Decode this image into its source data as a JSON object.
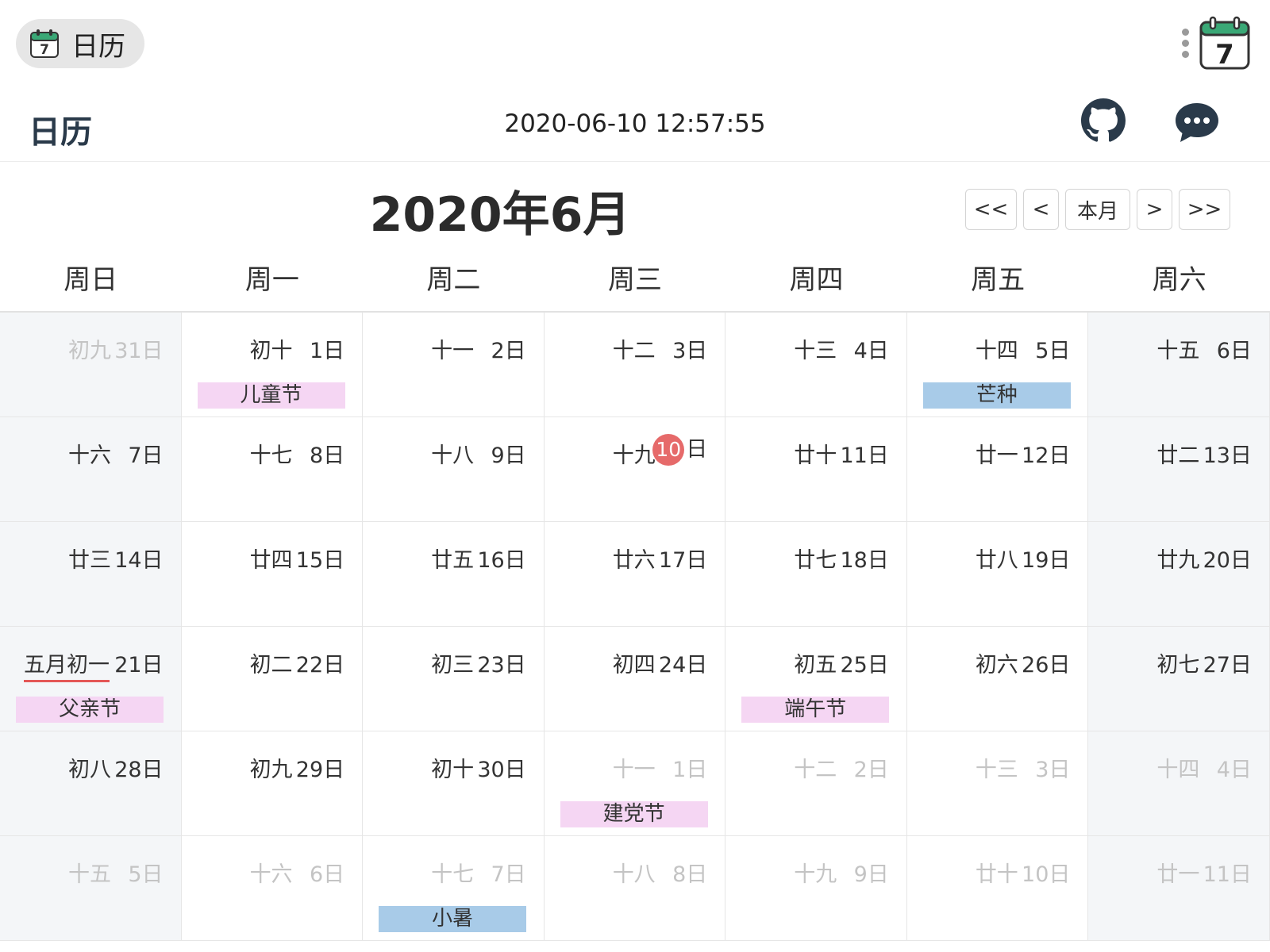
{
  "app": {
    "chip_title": "日历",
    "icon_day": "7"
  },
  "header": {
    "title": "日历",
    "datetime": "2020-06-10 12:57:55"
  },
  "calendar": {
    "month_title": "2020年6月",
    "nav": {
      "prev_year": "<<",
      "prev_month": "<",
      "this_month": "本月",
      "next_month": ">",
      "next_year": ">>"
    },
    "weekdays": [
      "周日",
      "周一",
      "周二",
      "周三",
      "周四",
      "周五",
      "周六"
    ],
    "weeks": [
      [
        {
          "lunar": "初九",
          "day": "31日",
          "muted": true
        },
        {
          "lunar": "初十",
          "day": "1日",
          "tag": "儿童节",
          "tag_type": "festival"
        },
        {
          "lunar": "十一",
          "day": "2日"
        },
        {
          "lunar": "十二",
          "day": "3日"
        },
        {
          "lunar": "十三",
          "day": "4日"
        },
        {
          "lunar": "十四",
          "day": "5日",
          "tag": "芒种",
          "tag_type": "solar-term"
        },
        {
          "lunar": "十五",
          "day": "6日"
        }
      ],
      [
        {
          "lunar": "十六",
          "day": "7日"
        },
        {
          "lunar": "十七",
          "day": "8日"
        },
        {
          "lunar": "十八",
          "day": "9日"
        },
        {
          "lunar": "十九",
          "day": "日",
          "today_num": "10"
        },
        {
          "lunar": "廿十",
          "day": "11日"
        },
        {
          "lunar": "廿一",
          "day": "12日"
        },
        {
          "lunar": "廿二",
          "day": "13日"
        }
      ],
      [
        {
          "lunar": "廿三",
          "day": "14日"
        },
        {
          "lunar": "廿四",
          "day": "15日"
        },
        {
          "lunar": "廿五",
          "day": "16日"
        },
        {
          "lunar": "廿六",
          "day": "17日"
        },
        {
          "lunar": "廿七",
          "day": "18日"
        },
        {
          "lunar": "廿八",
          "day": "19日"
        },
        {
          "lunar": "廿九",
          "day": "20日"
        }
      ],
      [
        {
          "lunar": "五月初一",
          "day": "21日",
          "underline": true,
          "tag": "父亲节",
          "tag_type": "festival"
        },
        {
          "lunar": "初二",
          "day": "22日"
        },
        {
          "lunar": "初三",
          "day": "23日"
        },
        {
          "lunar": "初四",
          "day": "24日"
        },
        {
          "lunar": "初五",
          "day": "25日",
          "tag": "端午节",
          "tag_type": "festival"
        },
        {
          "lunar": "初六",
          "day": "26日"
        },
        {
          "lunar": "初七",
          "day": "27日"
        }
      ],
      [
        {
          "lunar": "初八",
          "day": "28日"
        },
        {
          "lunar": "初九",
          "day": "29日"
        },
        {
          "lunar": "初十",
          "day": "30日"
        },
        {
          "lunar": "十一",
          "day": "1日",
          "muted": true,
          "tag": "建党节",
          "tag_type": "festival"
        },
        {
          "lunar": "十二",
          "day": "2日",
          "muted": true
        },
        {
          "lunar": "十三",
          "day": "3日",
          "muted": true
        },
        {
          "lunar": "十四",
          "day": "4日",
          "muted": true
        }
      ],
      [
        {
          "lunar": "十五",
          "day": "5日",
          "muted": true
        },
        {
          "lunar": "十六",
          "day": "6日",
          "muted": true
        },
        {
          "lunar": "十七",
          "day": "7日",
          "muted": true,
          "tag": "小暑",
          "tag_type": "solar-term"
        },
        {
          "lunar": "十八",
          "day": "8日",
          "muted": true
        },
        {
          "lunar": "十九",
          "day": "9日",
          "muted": true
        },
        {
          "lunar": "廿十",
          "day": "10日",
          "muted": true
        },
        {
          "lunar": "廿一",
          "day": "11日",
          "muted": true
        }
      ]
    ]
  },
  "colors": {
    "today": "#e66a6a",
    "festival": "#f5d6f3",
    "solar_term": "#a8cbe8",
    "weekend_bg": "#f4f6f8"
  }
}
